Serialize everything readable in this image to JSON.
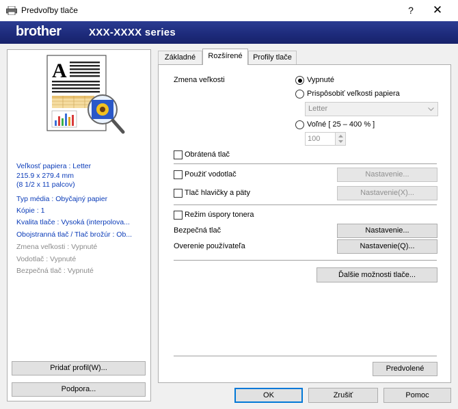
{
  "window": {
    "title": "Predvoľby tlače",
    "help_label": "?",
    "close_label": "✕"
  },
  "banner": {
    "logo": "brother",
    "series": "XXX-XXXX series"
  },
  "preview_info": {
    "paper_size": "Veľkosť papiera : Letter",
    "paper_dim1": "215.9 x 279.4 mm",
    "paper_dim2": "(8 1/2 x 11 palcov)",
    "media_type": "Typ média : Obyčajný papier",
    "copies": "Kópie : 1",
    "quality": "Kvalita tlače : Vysoká (interpolova...",
    "duplex": "Obojstranná tlač / Tlač brožúr : Ob...",
    "scaling": "Zmena veľkosti : Vypnuté",
    "watermark": "Vodotlač : Vypnuté",
    "secure": "Bezpečná tlač : Vypnuté"
  },
  "left_buttons": {
    "add_profile": "Pridať profil(W)...",
    "support": "Podpora..."
  },
  "tabs": [
    "Základné",
    "Rozšírené",
    "Profily tlače"
  ],
  "advanced": {
    "scaling_label": "Zmena veľkosti",
    "off_label": "Vypnuté",
    "fit_label": "Prispôsobiť veľkosti papiera",
    "paper_combo": "Letter",
    "free_label": "Voľné [ 25 – 400 % ]",
    "free_value": "100",
    "reverse_label": "Obrátená tlač",
    "watermark_label": "Použiť vodotlač",
    "watermark_btn": "Nastavenie...",
    "header_label": "Tlač hlavičky a päty",
    "header_btn": "Nastavenie(X)...",
    "toner_label": "Režim úspory tonera",
    "secure_label": "Bezpečná tlač",
    "secure_btn": "Nastavenie...",
    "auth_label": "Overenie používateľa",
    "auth_btn": "Nastavenie(Q)...",
    "more_btn": "Ďalšie možnosti tlače...",
    "default_btn": "Predvolené"
  },
  "footer": {
    "ok": "OK",
    "cancel": "Zrušiť",
    "help": "Pomoc"
  },
  "colors": {
    "banner": "#1d2a7a",
    "info_text": "#0a3bb8",
    "focus": "#0078d7"
  }
}
